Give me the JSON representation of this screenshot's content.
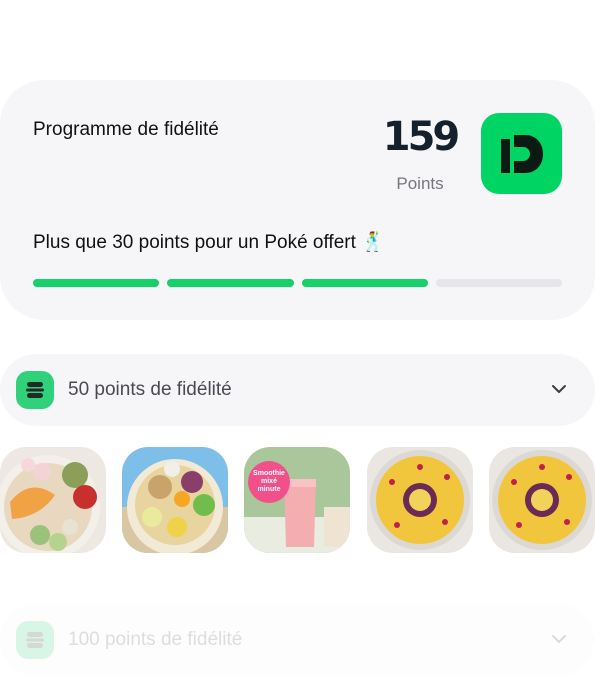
{
  "loyalty": {
    "title": "Programme de fidélité",
    "points_value": "159",
    "points_label": "Points",
    "subtitle": "Plus que 30 points pour un Poké offert 🕺",
    "progress_fraction": 0.75,
    "brand_color": "#00d563"
  },
  "rewards": [
    {
      "label": "50 points de fidélité",
      "icon": "burger-stack-icon",
      "items": [
        {
          "name": "poke-bowl-salmon-avocado"
        },
        {
          "name": "poke-bowl-chicken-edamame"
        },
        {
          "name": "smoothie",
          "badge": "Smoothie mixé minute"
        },
        {
          "name": "fruit-bowl-passion-fruit"
        },
        {
          "name": "fruit-bowl-passion-fruit"
        }
      ]
    },
    {
      "label": "100 points de fidélité",
      "icon": "burger-stack-icon"
    }
  ]
}
